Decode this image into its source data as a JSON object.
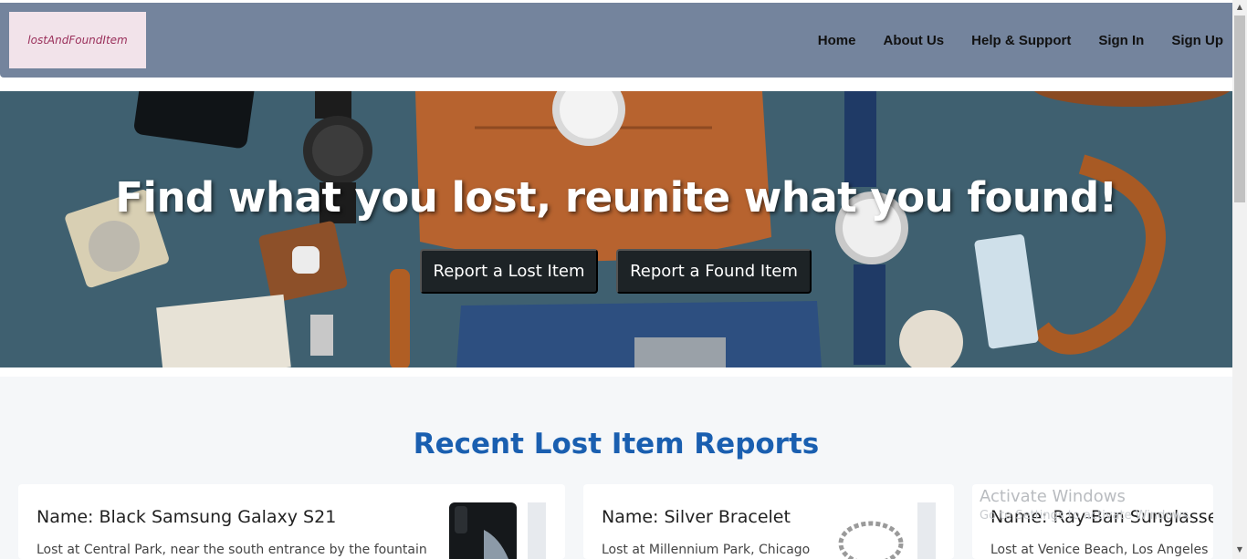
{
  "brand": {
    "logo_text": "lostAndFoundItem"
  },
  "nav": {
    "items": [
      {
        "label": "Home"
      },
      {
        "label": "About Us"
      },
      {
        "label": "Help & Support"
      },
      {
        "label": "Sign In"
      },
      {
        "label": "Sign Up"
      }
    ]
  },
  "hero": {
    "title": "Find what you lost, reunite what you found!",
    "lost_button": "Report a Lost Item",
    "found_button": "Report a Found Item"
  },
  "recent": {
    "title": "Recent Lost Item Reports",
    "cards": [
      {
        "name": "Name: Black Samsung Galaxy S21",
        "desc": "Lost at Central Park, near the south entrance by the fountain"
      },
      {
        "name": "Name: Silver Bracelet",
        "desc": "Lost at Millennium Park, Chicago"
      },
      {
        "name": "Name: Ray-Ban Sunglasses",
        "desc": "Lost at Venice Beach, Los Angeles"
      }
    ]
  },
  "os_watermark": {
    "line1": "Activate Windows",
    "line2": "Go to Settings to activate Windows."
  },
  "colors": {
    "navbar": "#74849d",
    "logo_bg": "#f2e3ea",
    "hero_bg": "#3f6070",
    "hero_button": "#1d2326",
    "section_title": "#1a5fb0"
  }
}
